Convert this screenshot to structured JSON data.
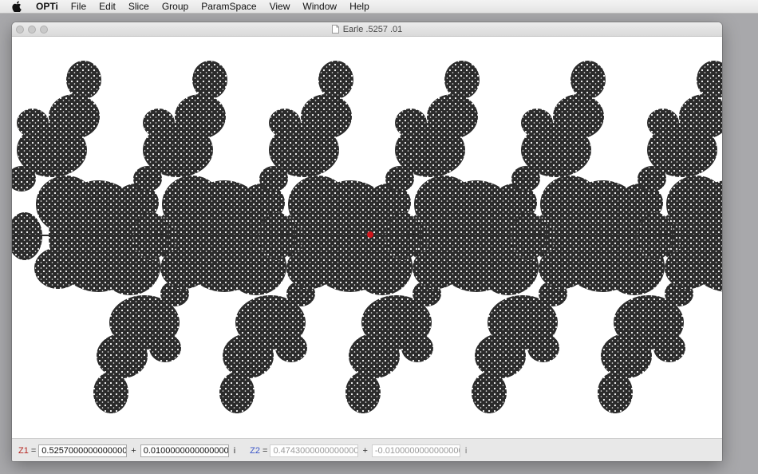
{
  "menubar": {
    "apple_icon": "apple-logo-icon",
    "items": [
      "OPTi",
      "File",
      "Edit",
      "Slice",
      "Group",
      "ParamSpace",
      "View",
      "Window",
      "Help"
    ]
  },
  "window": {
    "title": "Earle .5257 .01",
    "doc_icon": "document-icon"
  },
  "fractal": {
    "fill_color": "#2b2b2b",
    "marker_color": "#d0141c",
    "tile_count": 6
  },
  "params": {
    "z1_label": "Z1",
    "z1_real": "0.5257000000000000",
    "z1_imag": "0.0100000000000000",
    "z2_label": "Z2",
    "z2_real": "0.4743000000000000",
    "z2_imag": "-0.0100000000000000",
    "equals": "=",
    "plus": "+",
    "imag_unit": "i"
  }
}
